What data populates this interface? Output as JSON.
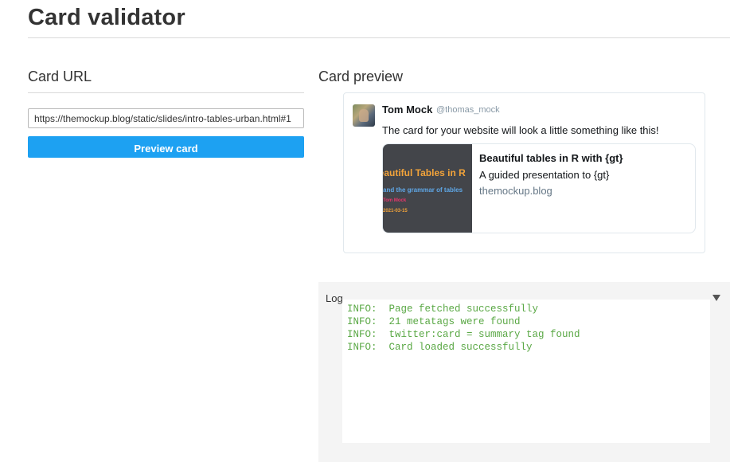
{
  "page": {
    "title": "Card validator"
  },
  "card_url_section": {
    "heading": "Card URL",
    "url_value": "https://themockup.blog/static/slides/intro-tables-urban.html#1",
    "preview_button_label": "Preview card"
  },
  "card_preview_section": {
    "heading": "Card preview",
    "tweet": {
      "name": "Tom Mock",
      "handle": "@thomas_mock",
      "text": "The card for your website will look a little something like this!",
      "avatar_icon": "user-photo-avatar"
    },
    "card": {
      "image_slide": {
        "title": "Beautiful Tables in R",
        "subtitle": "and the grammar of tables",
        "author": "Tom Mock",
        "date": "2021-03-15"
      },
      "title": "Beautiful tables in R with {gt}",
      "description": "A guided presentation to {gt}",
      "domain": "themockup.blog"
    }
  },
  "log": {
    "label": "Log",
    "toggle_icon": "chevron-down-icon",
    "lines": [
      "INFO:  Page fetched successfully",
      "INFO:  21 metatags were found",
      "INFO:  twitter:card = summary tag found",
      "INFO:  Card loaded successfully"
    ]
  },
  "colors": {
    "accent_button": "#1da1f2",
    "log_text": "#5aa845",
    "domain_text": "#657786"
  }
}
